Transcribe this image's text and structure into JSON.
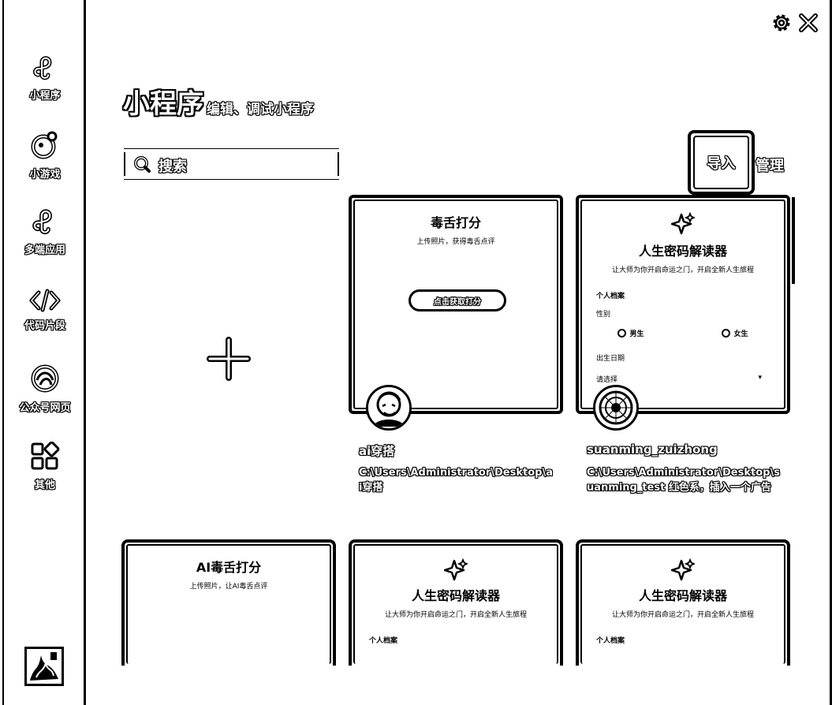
{
  "sidebar": {
    "items": [
      {
        "label": "小程序",
        "icon": "miniprogram-icon"
      },
      {
        "label": "小游戏",
        "icon": "game-icon"
      },
      {
        "label": "多端应用",
        "icon": "multiplatform-icon"
      },
      {
        "label": "代码片段",
        "icon": "code-icon"
      },
      {
        "label": "公众号网页",
        "icon": "webpage-icon"
      },
      {
        "label": "其他",
        "icon": "grid-icon"
      }
    ]
  },
  "header": {
    "title": "小程序",
    "subtitle": "编辑、调试小程序"
  },
  "search": {
    "placeholder": "搜索"
  },
  "actions": {
    "import_label": "导入",
    "manage_label": "管理"
  },
  "projects": [
    {
      "name": "ai穿搭",
      "path": "C:\\Users\\Administrator\\Desktop\\ai穿搭",
      "preview": {
        "title": "毒舌打分",
        "subtitle": "上传照片，获得毒舌点评",
        "button": "点击获取打分"
      }
    },
    {
      "name": "suanming_zuizhong",
      "path": "C:\\Users\\Administrator\\Desktop\\suanming_test  红色系，插入一个广告",
      "preview": {
        "title": "人生密码解读器",
        "subtitle": "让大师为你开启命运之门，开启全新人生旅程",
        "section": "个人档案",
        "gender_label": "性别",
        "male": "男生",
        "female": "女生",
        "birth_label": "出生日期",
        "birth_value": "请选择"
      }
    }
  ],
  "bottom_cards": [
    {
      "title": "AI毒舌打分",
      "subtitle": "上传照片，让AI毒舌点评"
    },
    {
      "title": "人生密码解读器",
      "subtitle": "让大师为你开启命运之门，开启全新人生旅程",
      "section": "个人档案"
    },
    {
      "title": "人生密码解读器",
      "subtitle": "让大师为你开启命运之门，开启全新人生旅程",
      "section": "个人档案"
    }
  ]
}
